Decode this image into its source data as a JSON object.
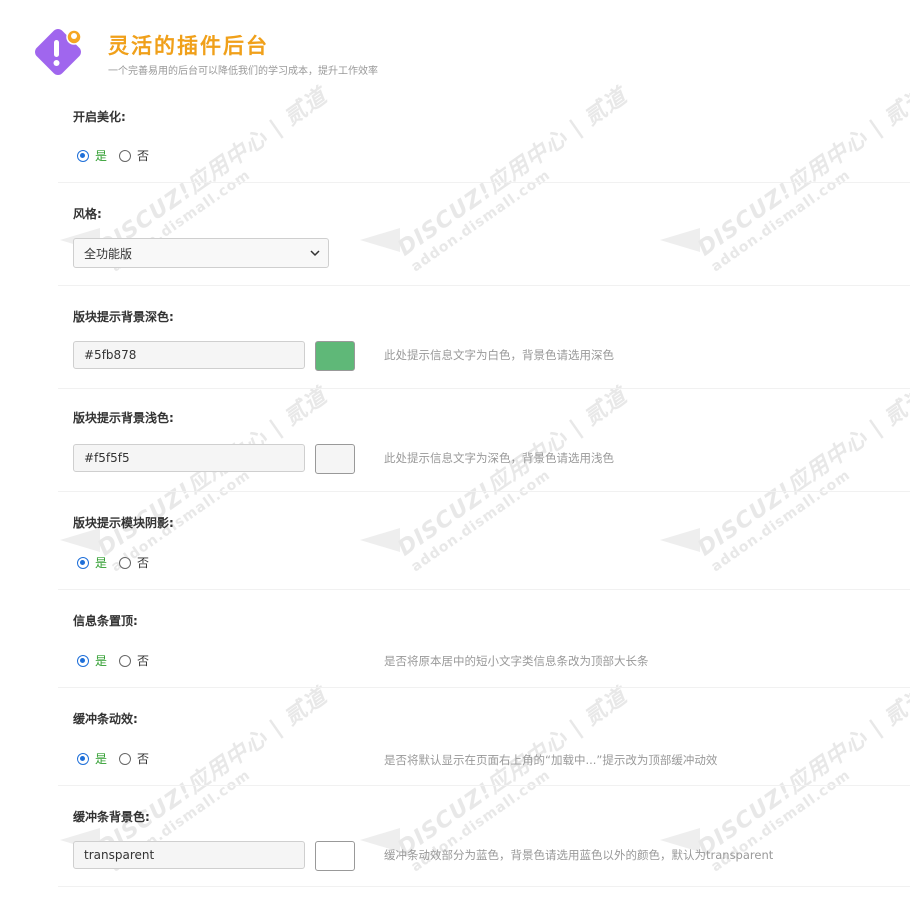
{
  "brand": {
    "title": "灵活的插件后台",
    "subtitle": "一个完善易用的后台可以降低我们的学习成本，提升工作效率",
    "logo_icon": "exclamation-lightbulb-icon",
    "logo_color": "#a066ee",
    "title_color": "#f0a01a"
  },
  "watermark": {
    "line1": "DISCUZ!应用中心 | 贰道",
    "line2": "addon.dismall.com"
  },
  "settings": [
    {
      "label": "开启美化:",
      "type": "radio",
      "options": [
        "是",
        "否"
      ],
      "selected": 0,
      "hint": ""
    },
    {
      "label": "风格:",
      "type": "select",
      "value": "全功能版"
    },
    {
      "label": "版块提示背景深色:",
      "type": "color",
      "value": "#5fb878",
      "swatch": "#5fb878",
      "hint": "此处提示信息文字为白色，背景色请选用深色"
    },
    {
      "label": "版块提示背景浅色:",
      "type": "color",
      "value": "#f5f5f5",
      "swatch": "#f5f5f5",
      "hint": "此处提示信息文字为深色，背景色请选用浅色"
    },
    {
      "label": "版块提示模块阴影:",
      "type": "radio",
      "options": [
        "是",
        "否"
      ],
      "selected": 0,
      "hint": ""
    },
    {
      "label": "信息条置顶:",
      "type": "radio",
      "options": [
        "是",
        "否"
      ],
      "selected": 0,
      "hint": "是否将原本居中的短小文字类信息条改为顶部大长条"
    },
    {
      "label": "缓冲条动效:",
      "type": "radio",
      "options": [
        "是",
        "否"
      ],
      "selected": 0,
      "hint": "是否将默认显示在页面右上角的“加载中...”提示改为顶部缓冲动效"
    },
    {
      "label": "缓冲条背景色:",
      "type": "color",
      "value": "transparent",
      "swatch": "#ffffff",
      "hint": "缓冲条动效部分为蓝色，背景色请选用蓝色以外的颜色，默认为transparent"
    }
  ]
}
